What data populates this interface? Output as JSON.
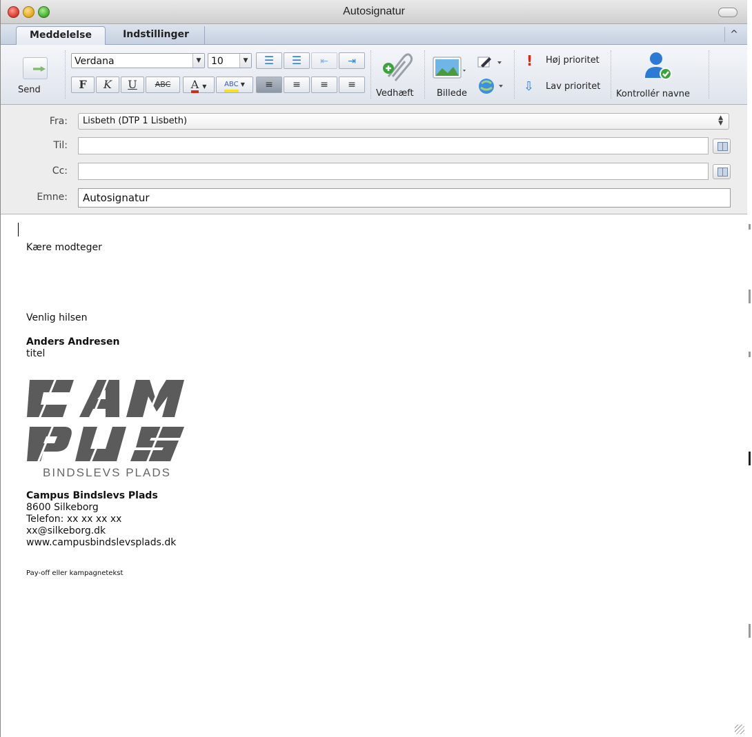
{
  "window": {
    "title": "Autosignatur"
  },
  "tabs": [
    {
      "label": "Meddelelse",
      "active": true
    },
    {
      "label": "Indstillinger",
      "active": false
    }
  ],
  "ribbon": {
    "send_label": "Send",
    "font": {
      "family": "Verdana",
      "size": "10"
    },
    "format_buttons": {
      "bold": "F",
      "italic": "K",
      "underline": "U",
      "strike": "ABC",
      "font_color": "A",
      "highlight": "ABC"
    },
    "attach_label": "Vedhæft",
    "picture_label": "Billede",
    "high_priority_label": "Høj prioritet",
    "low_priority_label": "Lav prioritet",
    "check_names_label": "Kontrollér navne"
  },
  "header": {
    "from_label": "Fra:",
    "from_value": "Lisbeth (DTP 1 Lisbeth)",
    "to_label": "Til:",
    "to_value": "",
    "cc_label": "Cc:",
    "cc_value": "",
    "subject_label": "Emne:",
    "subject_value": "Autosignatur"
  },
  "message": {
    "greeting": "Kære modteger",
    "closing": "Venlig hilsen",
    "name": "Anders Andresen",
    "title": "titel",
    "logo_text": "BINDSLEVS PLADS",
    "org": "Campus Bindslevs Plads",
    "city": "8600 Silkeborg",
    "phone": "Telefon: xx xx xx xx",
    "email": "xx@silkeborg.dk",
    "web": "www.campusbindslevsplads.dk",
    "payoff": "Pay-off eller kampagnetekst"
  },
  "colors": {
    "logo_gray": "#5b5b5b",
    "accent_blue": "#2b7bd6",
    "priority_red": "#d42a1a"
  }
}
